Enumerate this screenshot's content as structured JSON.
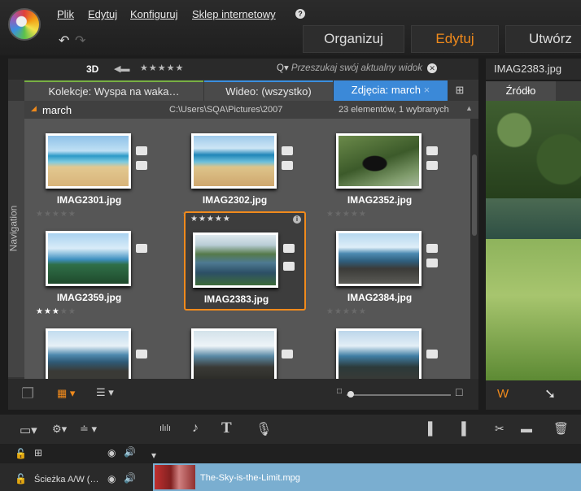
{
  "menu": {
    "items": [
      "Plik",
      "Edytuj",
      "Konfiguruj",
      "Sklep internetowy"
    ]
  },
  "top_tabs": {
    "organize": "Organizuj",
    "edit": "Edytuj",
    "create": "Utwórz"
  },
  "library": {
    "mode_3d": "3D",
    "search_placeholder": "Przeszukaj swój aktualny widok",
    "tabs": [
      "Kolekcje: Wyspa na waka…",
      "Wideo: (wszystko)",
      "Zdjęcia: march"
    ],
    "nav_label": "Navigation",
    "folder": {
      "name": "march",
      "path": "C:\\Users\\SQA\\Pictures\\2007",
      "count": "23 elementów, 1 wybranych"
    },
    "items": [
      {
        "name": "IMAG2301.jpg",
        "rating": 0,
        "selected": false
      },
      {
        "name": "IMAG2302.jpg",
        "rating": 0,
        "selected": false
      },
      {
        "name": "IMAG2352.jpg",
        "rating": 0,
        "selected": false
      },
      {
        "name": "IMAG2359.jpg",
        "rating": 3,
        "selected": false
      },
      {
        "name": "IMAG2383.jpg",
        "rating": 0,
        "selected": true
      },
      {
        "name": "IMAG2384.jpg",
        "rating": 0,
        "selected": false
      }
    ]
  },
  "preview": {
    "filename": "IMAG2383.jpg",
    "source_tab": "Źródło"
  },
  "timeline": {
    "track_label": "Ścieżka A/W (…",
    "clip_name": "The-Sky-is-the-Limit.mpg"
  },
  "colors": {
    "accent_orange": "#f08a1c",
    "tab_blue": "#3b89d8",
    "tab_green": "#78b043"
  }
}
